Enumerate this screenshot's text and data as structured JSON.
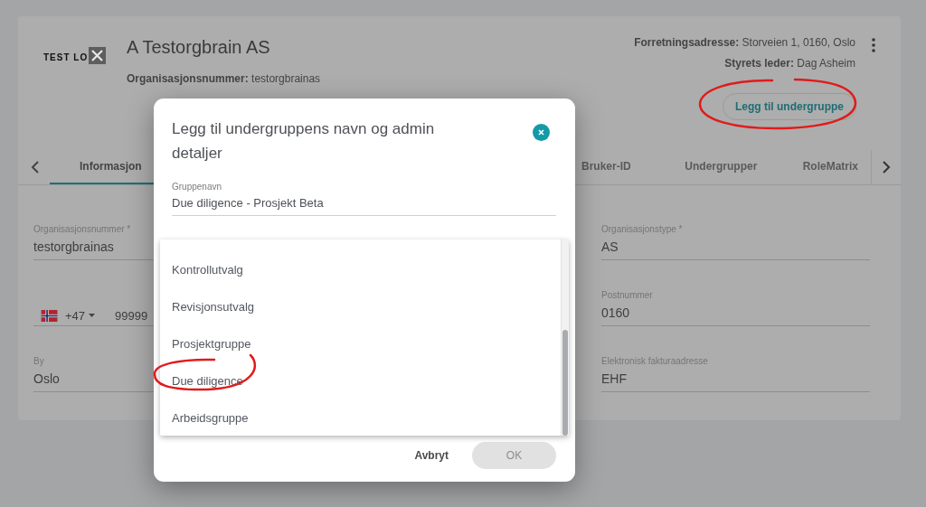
{
  "header": {
    "logo_text": "TEST LO",
    "title": "A Testorgbrain AS",
    "org_number_label": "Organisasjonsnummer:",
    "org_number": "testorgbrainas",
    "address_label": "Forretningsadresse:",
    "address": "Storveien 1, 0160, Oslo",
    "chair_label": "Styrets leder:",
    "chair": "Dag Asheim",
    "add_button": {
      "label": "Legg til undergruppe",
      "highlighted": true
    }
  },
  "tabs": [
    {
      "label": "Informasjon",
      "selected": true
    },
    {
      "label": "Bruker-ID",
      "selected": false
    },
    {
      "label": "Undergrupper",
      "selected": false
    },
    {
      "label": "RoleMatrix",
      "selected": false
    }
  ],
  "form": [
    {
      "kind": "text",
      "label": "Organisasjonsnummer *",
      "value": "testorgbrainas"
    },
    {
      "kind": "text",
      "label": "Organisasjonstype *",
      "value": "AS"
    },
    {
      "kind": "phone",
      "country_code": "+47",
      "value": "99999"
    },
    {
      "kind": "text",
      "label": "Postnummer",
      "value": "0160"
    },
    {
      "kind": "text",
      "label": "By",
      "value": "Oslo"
    },
    {
      "kind": "text",
      "label": "Elektronisk fakturaadresse",
      "value": "EHF"
    }
  ],
  "dialog": {
    "title": "Legg til undergruppens navn og admin detaljer",
    "name_label": "Gruppenavn",
    "name_value": "Due diligence - Prosjekt Beta",
    "options": [
      {
        "label": "Kontrollutvalg",
        "highlighted": false
      },
      {
        "label": "Revisjonsutvalg",
        "highlighted": false
      },
      {
        "label": "Prosjektgruppe",
        "highlighted": false
      },
      {
        "label": "Due diligence",
        "highlighted": true
      },
      {
        "label": "Arbeidsgruppe",
        "highlighted": false
      }
    ],
    "cancel": "Avbryt",
    "ok": {
      "label": "OK",
      "disabled": true
    }
  }
}
